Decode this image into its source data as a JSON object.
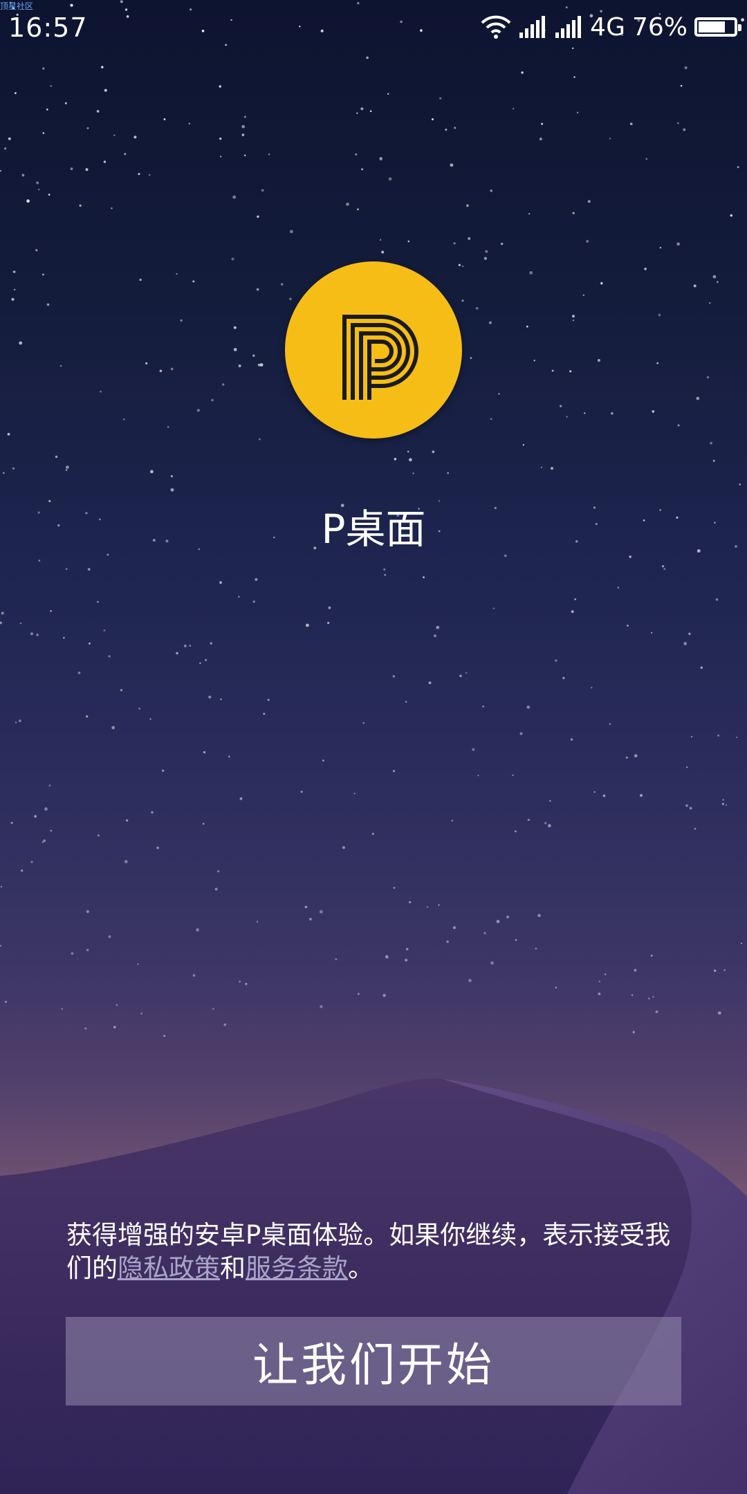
{
  "watermark": "顶星社区",
  "status_bar": {
    "time": "16:57",
    "network": "4G",
    "battery_percent": "76%",
    "battery_level": 0.76,
    "icons": [
      "wifi-icon",
      "signal-icon",
      "signal-icon",
      "battery-icon"
    ]
  },
  "app": {
    "logo_icon": "pixel-p-logo-icon",
    "logo_color": "#f6bd16",
    "name": "P桌面"
  },
  "consent": {
    "text_before": "获得增强的安卓P桌面体验。如果你继续，表示接受我们的",
    "privacy_link": "隐私政策",
    "joiner": "和",
    "terms_link": "服务条款",
    "text_after": "。"
  },
  "start_button_label": "让我们开始"
}
